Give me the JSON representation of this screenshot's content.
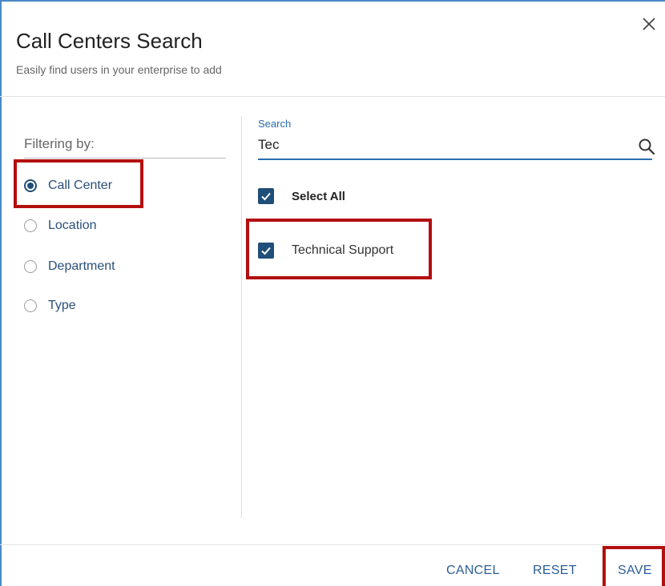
{
  "dialog": {
    "title": "Call Centers Search",
    "subtitle": "Easily find users in your enterprise to add",
    "close_icon": "close-icon"
  },
  "filters": {
    "label": "Filtering by:",
    "options": [
      {
        "label": "Call Center",
        "selected": true
      },
      {
        "label": "Location",
        "selected": false
      },
      {
        "label": "Department",
        "selected": false
      },
      {
        "label": "Type",
        "selected": false
      }
    ]
  },
  "search": {
    "label": "Search",
    "value": "Tec",
    "icon": "search-icon"
  },
  "results": {
    "select_all": {
      "label": "Select All",
      "checked": true
    },
    "items": [
      {
        "label": "Technical Support",
        "checked": true
      }
    ]
  },
  "footer": {
    "cancel": "CANCEL",
    "reset": "RESET",
    "save": "SAVE"
  },
  "colors": {
    "accent": "#1f4e79",
    "link": "#2a5d99",
    "highlight": "#b30f0f"
  }
}
